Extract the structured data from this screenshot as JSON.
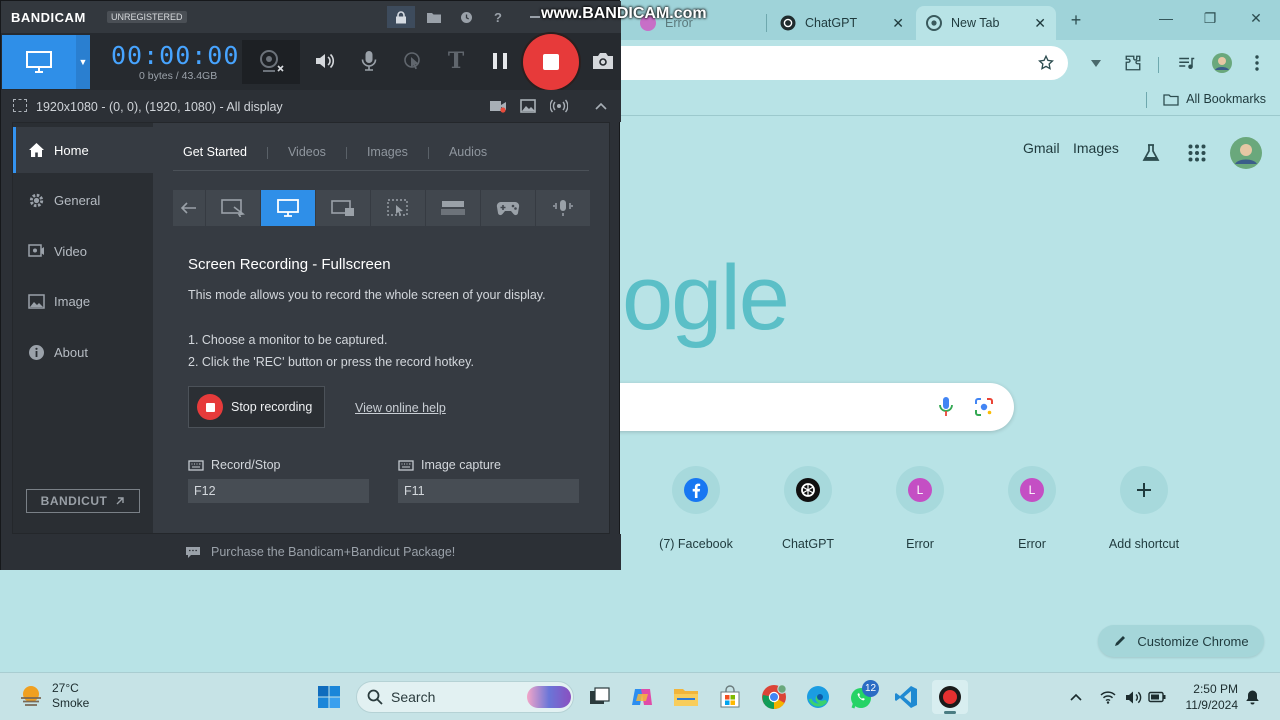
{
  "chrome": {
    "tabs": [
      {
        "label": "Error"
      },
      {
        "label": "ChatGPT"
      },
      {
        "label": "New Tab"
      }
    ],
    "bookmarks": {
      "all_label": "All Bookmarks"
    },
    "header_links": {
      "gmail": "Gmail",
      "images": "Images"
    },
    "logo_text": "ogle",
    "shortcuts": [
      {
        "label": "(7) Facebook",
        "icon": "facebook-icon"
      },
      {
        "label": "ChatGPT",
        "icon": "chatgpt-icon"
      },
      {
        "label": "Error",
        "icon": "letter-l-icon",
        "letter": "L"
      },
      {
        "label": "Error",
        "icon": "letter-l-icon",
        "letter": "L"
      },
      {
        "label": "Add shortcut",
        "icon": "plus-icon"
      }
    ],
    "truncated_label": ".",
    "customize_label": "Customize Chrome",
    "colors": {
      "bg": "#b8e3e6",
      "tabstrip": "#9fd3d9",
      "logo": "#5bbfc7"
    }
  },
  "bandicam": {
    "logo": "BANDICAM",
    "unregistered": "UNREGISTERED",
    "watermark": "www.BANDICAM.com",
    "timer": "00:00:00",
    "bytes": "0 bytes / 43.4GB",
    "resolution": "1920x1080 - (0, 0), (1920, 1080) - All display",
    "sidebar": [
      {
        "label": "Home",
        "icon": "home-icon"
      },
      {
        "label": "General",
        "icon": "gear-icon"
      },
      {
        "label": "Video",
        "icon": "video-icon"
      },
      {
        "label": "Image",
        "icon": "image-icon"
      },
      {
        "label": "About",
        "icon": "info-icon"
      }
    ],
    "bandicut_label": "BANDICUT",
    "tabs": [
      "Get Started",
      "Videos",
      "Images",
      "Audios"
    ],
    "heading": "Screen Recording - Fullscreen",
    "description": "This mode allows you to record the whole screen of your display.",
    "step1": "1. Choose a monitor to be captured.",
    "step2": "2. Click the 'REC' button or press the record hotkey.",
    "stop_label": "Stop recording",
    "help_label": "View online help",
    "hotkeys": {
      "record_label": "Record/Stop",
      "record_value": "F12",
      "image_label": "Image capture",
      "image_value": "F11"
    },
    "footer": "Purchase the Bandicam+Bandicut Package!",
    "colors": {
      "accent": "#2f8fe8",
      "rec": "#e73a3a",
      "timer": "#47a4ff"
    }
  },
  "taskbar": {
    "weather": {
      "temp": "27°C",
      "condition": "Smoke"
    },
    "search_label": "Search",
    "whatsapp_badge": "12",
    "clock": {
      "time": "2:50 PM",
      "date": "11/9/2024"
    }
  }
}
